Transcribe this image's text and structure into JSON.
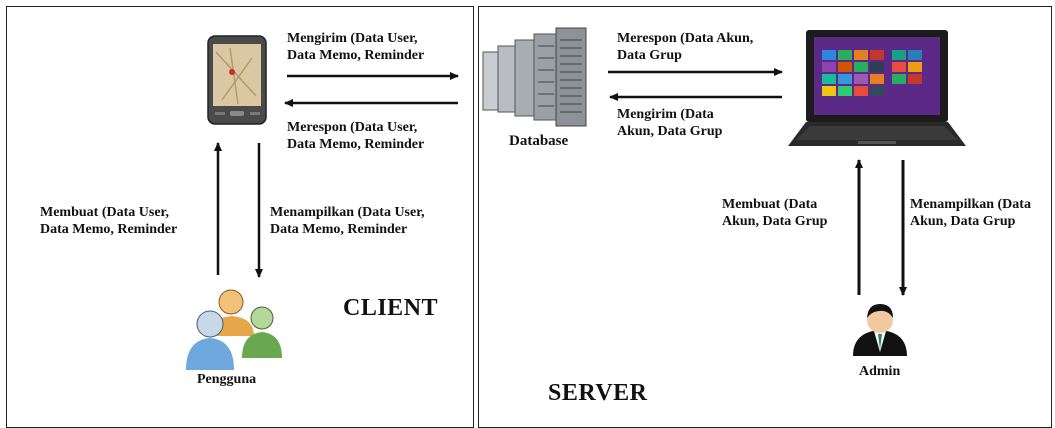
{
  "client": {
    "title": "CLIENT",
    "send_label": [
      "Mengirim (Data User,",
      "Data Memo, Reminder"
    ],
    "response_label": [
      "Merespon (Data User,",
      "Data Memo, Reminder"
    ],
    "create_label": [
      "Membuat (Data User,",
      "Data Memo, Reminder"
    ],
    "display_label": [
      "Menampilkan (Data User,",
      "Data Memo, Reminder"
    ],
    "actor_label": "Pengguna"
  },
  "server": {
    "title": "SERVER",
    "database_label": "Database",
    "response_label": [
      "Merespon (Data Akun,",
      "Data Grup"
    ],
    "send_label": [
      "Mengirim (Data",
      "Akun, Data Grup"
    ],
    "create_label": [
      "Membuat (Data",
      "Akun, Data Grup"
    ],
    "display_label": [
      "Menampilkan (Data",
      "Akun, Data Grup"
    ],
    "actor_label": "Admin"
  },
  "colors": {
    "frame": "#222222",
    "arrow": "#111111",
    "phone_body": "#4a4a4a",
    "laptop_body": "#1c1c1c",
    "server_rack": "#9aa0a6",
    "users_green": "#6aa84f",
    "users_blue": "#6fa8dc",
    "users_orange": "#e6a64a",
    "admin_tie": "#2e8b57"
  },
  "icons": [
    "smartphone-icon",
    "database-servers-icon",
    "laptop-icon",
    "users-group-icon",
    "admin-user-icon"
  ]
}
